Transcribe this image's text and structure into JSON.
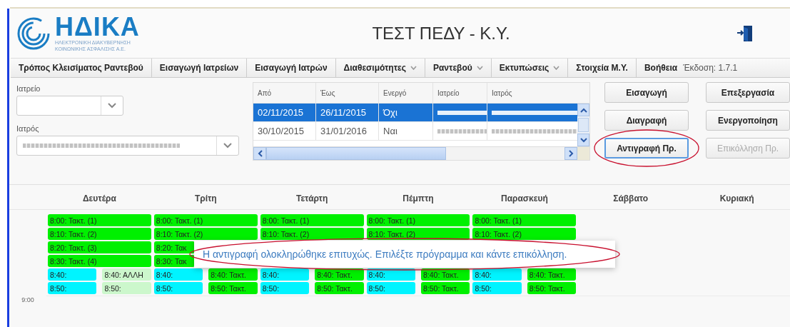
{
  "header": {
    "logo_name": "ΗΔΙΚΑ",
    "logo_subtitle": [
      "ΗΛΕΚΤΡΟΝΙΚΗ ΔΙΑΚΥΒΕΡΝΗΣΗ",
      "ΚΟΙΝΩΝΙΚΗΣ ΑΣΦΑΛΙΣΗΣ Α.Ε."
    ],
    "title": "ΤΕΣΤ ΠΕΔΥ - Κ.Υ."
  },
  "menu": [
    {
      "label": "Τρόπος Κλεισίματος Ραντεβού",
      "dropdown": false
    },
    {
      "label": "Εισαγωγή Ιατρείων",
      "dropdown": false
    },
    {
      "label": "Εισαγωγή Ιατρών",
      "dropdown": false
    },
    {
      "label": "Διαθεσιμότητες",
      "dropdown": true
    },
    {
      "label": "Ραντεβού",
      "dropdown": true
    },
    {
      "label": "Εκτυπώσεις",
      "dropdown": true
    },
    {
      "label": "Στοιχεία Μ.Υ.",
      "dropdown": false
    },
    {
      "label": "Βοήθεια",
      "dropdown": false
    }
  ],
  "version": "Έκδοση: 1.7.1",
  "filters": [
    {
      "label": "Ιατρείο",
      "redacted": false
    },
    {
      "label": "Ιατρός",
      "redacted": true
    }
  ],
  "table": {
    "columns": [
      "Από",
      "Έως",
      "Ενεργό",
      "Ιατρείο",
      "Ιατρός"
    ],
    "rows": [
      {
        "selected": true,
        "cells": [
          "02/11/2015",
          "26/11/2015",
          "Όχι"
        ]
      },
      {
        "selected": false,
        "cells": [
          "30/10/2015",
          "31/01/2016",
          "Ναι"
        ]
      }
    ]
  },
  "buttons": [
    {
      "label": "Εισαγωγή",
      "disabled": false,
      "focused": false
    },
    {
      "label": "Επεξεργασία",
      "disabled": false,
      "focused": false
    },
    {
      "label": "Διαγραφή",
      "disabled": false,
      "focused": false
    },
    {
      "label": "Ενεργοποίηση",
      "disabled": false,
      "focused": false
    },
    {
      "label": "Αντιγραφή Πρ.",
      "disabled": false,
      "focused": true,
      "circled": true
    },
    {
      "label": "Επικόλληση Πρ.",
      "disabled": true,
      "focused": false
    }
  ],
  "calendar": {
    "time_label": "9:00",
    "days": [
      {
        "name": "Δευτέρα",
        "rows": [
          {
            "events": [
              {
                "text": "8:00: Τακτ. (1)",
                "kind": "regular"
              }
            ]
          },
          {
            "events": [
              {
                "text": "8:10: Τακτ. (2)",
                "kind": "regular"
              }
            ]
          },
          {
            "events": [
              {
                "text": "8:20: Τακτ. (3)",
                "kind": "regular"
              }
            ]
          },
          {
            "events": [
              {
                "text": "8:30: Τακτ. (4)",
                "kind": "regular"
              }
            ]
          },
          {
            "events": [
              {
                "text": "8:40:",
                "kind": "free"
              },
              {
                "text": "8:40: ΑΛΛΗ",
                "kind": "other"
              }
            ]
          },
          {
            "events": [
              {
                "text": "8:50:",
                "kind": "free"
              },
              {
                "text": "8:50:",
                "kind": "other"
              }
            ]
          }
        ]
      },
      {
        "name": "Τρίτη",
        "rows": [
          {
            "events": [
              {
                "text": "8:00: Τακτ. (1)",
                "kind": "regular"
              }
            ]
          },
          {
            "events": [
              {
                "text": "8:10: Τακτ. (2)",
                "kind": "regular"
              }
            ]
          },
          {
            "events": [
              {
                "text": "8:20: Τακ",
                "kind": "regular",
                "covered": true
              }
            ]
          },
          {
            "events": [
              {
                "text": "8:30: Τακ",
                "kind": "regular",
                "covered": true
              }
            ]
          },
          {
            "events": [
              {
                "text": "8:40:",
                "kind": "free"
              },
              {
                "text": "8:40: Τακτ.",
                "kind": "regular"
              }
            ]
          },
          {
            "events": [
              {
                "text": "8:50:",
                "kind": "free"
              },
              {
                "text": "8:50: Τακτ.",
                "kind": "regular"
              }
            ]
          }
        ]
      },
      {
        "name": "Τετάρτη",
        "rows": [
          {
            "events": [
              {
                "text": "8:00: Τακτ. (1)",
                "kind": "regular"
              }
            ]
          },
          {
            "events": [
              {
                "text": "8:10: Τακτ. (2)",
                "kind": "regular"
              }
            ]
          },
          {},
          {},
          {
            "events": [
              {
                "text": "8:40:",
                "kind": "free"
              },
              {
                "text": "8:40: Τακτ.",
                "kind": "regular"
              }
            ]
          },
          {
            "events": [
              {
                "text": "8:50:",
                "kind": "free"
              },
              {
                "text": "8:50: Τακτ.",
                "kind": "regular"
              }
            ]
          }
        ]
      },
      {
        "name": "Πέμπτη",
        "rows": [
          {
            "events": [
              {
                "text": "8:00: Τακτ. (1)",
                "kind": "regular"
              }
            ]
          },
          {
            "events": [
              {
                "text": "8:10: Τακτ. (2)",
                "kind": "regular"
              }
            ]
          },
          {},
          {},
          {
            "events": [
              {
                "text": "8:40:",
                "kind": "free"
              },
              {
                "text": "8:40: Τακτ.",
                "kind": "regular"
              }
            ]
          },
          {
            "events": [
              {
                "text": "8:50:",
                "kind": "free"
              },
              {
                "text": "8:50: Τακτ.",
                "kind": "regular"
              }
            ]
          }
        ]
      },
      {
        "name": "Παρασκευή",
        "rows": [
          {
            "events": [
              {
                "text": "8:00: Τακτ. (1)",
                "kind": "regular"
              }
            ]
          },
          {
            "events": [
              {
                "text": "8:10: Τακτ. (2)",
                "kind": "regular"
              }
            ]
          },
          {},
          {},
          {
            "events": [
              {
                "text": "8:40:",
                "kind": "free"
              },
              {
                "text": "8:40: Τακτ.",
                "kind": "regular"
              }
            ]
          },
          {
            "events": [
              {
                "text": "8:50:",
                "kind": "free"
              },
              {
                "text": "8:50: Τακτ.",
                "kind": "regular"
              }
            ]
          }
        ]
      },
      {
        "name": "Σάββατο"
      },
      {
        "name": "Κυριακή"
      }
    ]
  },
  "toast": {
    "message": "Η αντιγραφή ολοκληρώθηκε επιτυχώς. Επιλέξτε πρόγραμμα και κάντε επικόλληση.",
    "circled": true
  }
}
